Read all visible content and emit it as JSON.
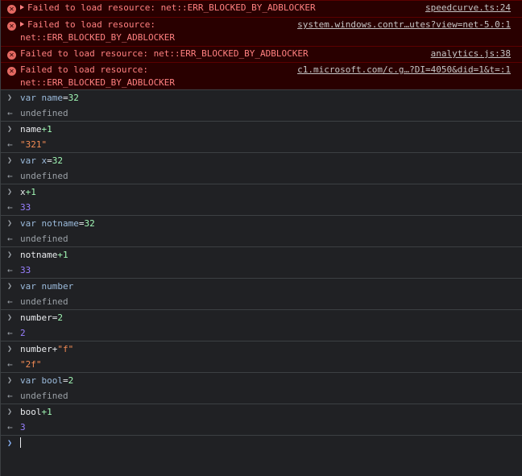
{
  "errors": [
    {
      "message": "Failed to load resource: net::ERR_BLOCKED_BY_ADBLOCKER",
      "line2": "",
      "source": "speedcurve.ts:24",
      "expandable": true
    },
    {
      "message": "Failed to load resource:",
      "line2": "net::ERR_BLOCKED_BY_ADBLOCKER",
      "source": "system.windows.contr…utes?view=net-5.0:1",
      "expandable": true
    },
    {
      "message": "Failed to load resource: net::ERR_BLOCKED_BY_ADBLOCKER",
      "line2": "",
      "source": "analytics.js:38",
      "expandable": false
    },
    {
      "message": "Failed to load resource:",
      "line2": "net::ERR_BLOCKED_BY_ADBLOCKER",
      "source": "c1.microsoft.com/c.g…?DI=4050&did=1&t=:1",
      "expandable": false
    }
  ],
  "icons": {
    "error": "error-circle-icon",
    "expand": "expand-triangle-icon",
    "input": "chevron-right-icon",
    "output": "result-arrow-icon"
  },
  "entries": [
    {
      "kind": "input",
      "parts": [
        [
          "kw",
          "var "
        ],
        [
          "vn",
          "name"
        ],
        [
          "op",
          "="
        ],
        [
          "num",
          "32"
        ]
      ]
    },
    {
      "kind": "output",
      "parts": [
        [
          "undef",
          "undefined"
        ]
      ]
    },
    {
      "kind": "input",
      "parts": [
        [
          "plain",
          "name"
        ],
        [
          "num",
          "+1"
        ]
      ]
    },
    {
      "kind": "output",
      "parts": [
        [
          "sres",
          "\"321\""
        ]
      ]
    },
    {
      "kind": "input",
      "parts": [
        [
          "kw",
          "var "
        ],
        [
          "vn",
          "x"
        ],
        [
          "op",
          "="
        ],
        [
          "num",
          "32"
        ]
      ]
    },
    {
      "kind": "output",
      "parts": [
        [
          "undef",
          "undefined"
        ]
      ]
    },
    {
      "kind": "input",
      "parts": [
        [
          "plain",
          "x"
        ],
        [
          "num",
          "+1"
        ]
      ]
    },
    {
      "kind": "output",
      "parts": [
        [
          "nres",
          "33"
        ]
      ]
    },
    {
      "kind": "input",
      "parts": [
        [
          "kw",
          "var "
        ],
        [
          "vn",
          "notname"
        ],
        [
          "op",
          "="
        ],
        [
          "num",
          "32"
        ]
      ]
    },
    {
      "kind": "output",
      "parts": [
        [
          "undef",
          "undefined"
        ]
      ]
    },
    {
      "kind": "input",
      "parts": [
        [
          "plain",
          "notname"
        ],
        [
          "num",
          "+1"
        ]
      ]
    },
    {
      "kind": "output",
      "parts": [
        [
          "nres",
          "33"
        ]
      ]
    },
    {
      "kind": "input",
      "parts": [
        [
          "kw",
          "var "
        ],
        [
          "vn",
          "number"
        ]
      ]
    },
    {
      "kind": "output",
      "parts": [
        [
          "undef",
          "undefined"
        ]
      ]
    },
    {
      "kind": "input",
      "parts": [
        [
          "plain",
          "number"
        ],
        [
          "op",
          "="
        ],
        [
          "num",
          "2"
        ]
      ]
    },
    {
      "kind": "output",
      "parts": [
        [
          "nres",
          "2"
        ]
      ]
    },
    {
      "kind": "input",
      "parts": [
        [
          "plain",
          "number"
        ],
        [
          "op",
          "+"
        ],
        [
          "str",
          "\"f\""
        ]
      ]
    },
    {
      "kind": "output",
      "parts": [
        [
          "sres",
          "\"2f\""
        ]
      ]
    },
    {
      "kind": "input",
      "parts": [
        [
          "kw",
          "var "
        ],
        [
          "vn",
          "bool"
        ],
        [
          "op",
          "="
        ],
        [
          "num",
          "2"
        ]
      ]
    },
    {
      "kind": "output",
      "parts": [
        [
          "undef",
          "undefined"
        ]
      ]
    },
    {
      "kind": "input",
      "parts": [
        [
          "plain",
          "bool"
        ],
        [
          "num",
          "+1"
        ]
      ]
    },
    {
      "kind": "output",
      "parts": [
        [
          "nres",
          "3"
        ]
      ]
    }
  ],
  "prompt": {
    "value": ""
  },
  "colors": {
    "error_bg": "#290000",
    "error_text": "#ff8080",
    "number": "#9980ff",
    "string": "#f28b54",
    "keyword": "#9bbbdc",
    "background": "#202124"
  }
}
